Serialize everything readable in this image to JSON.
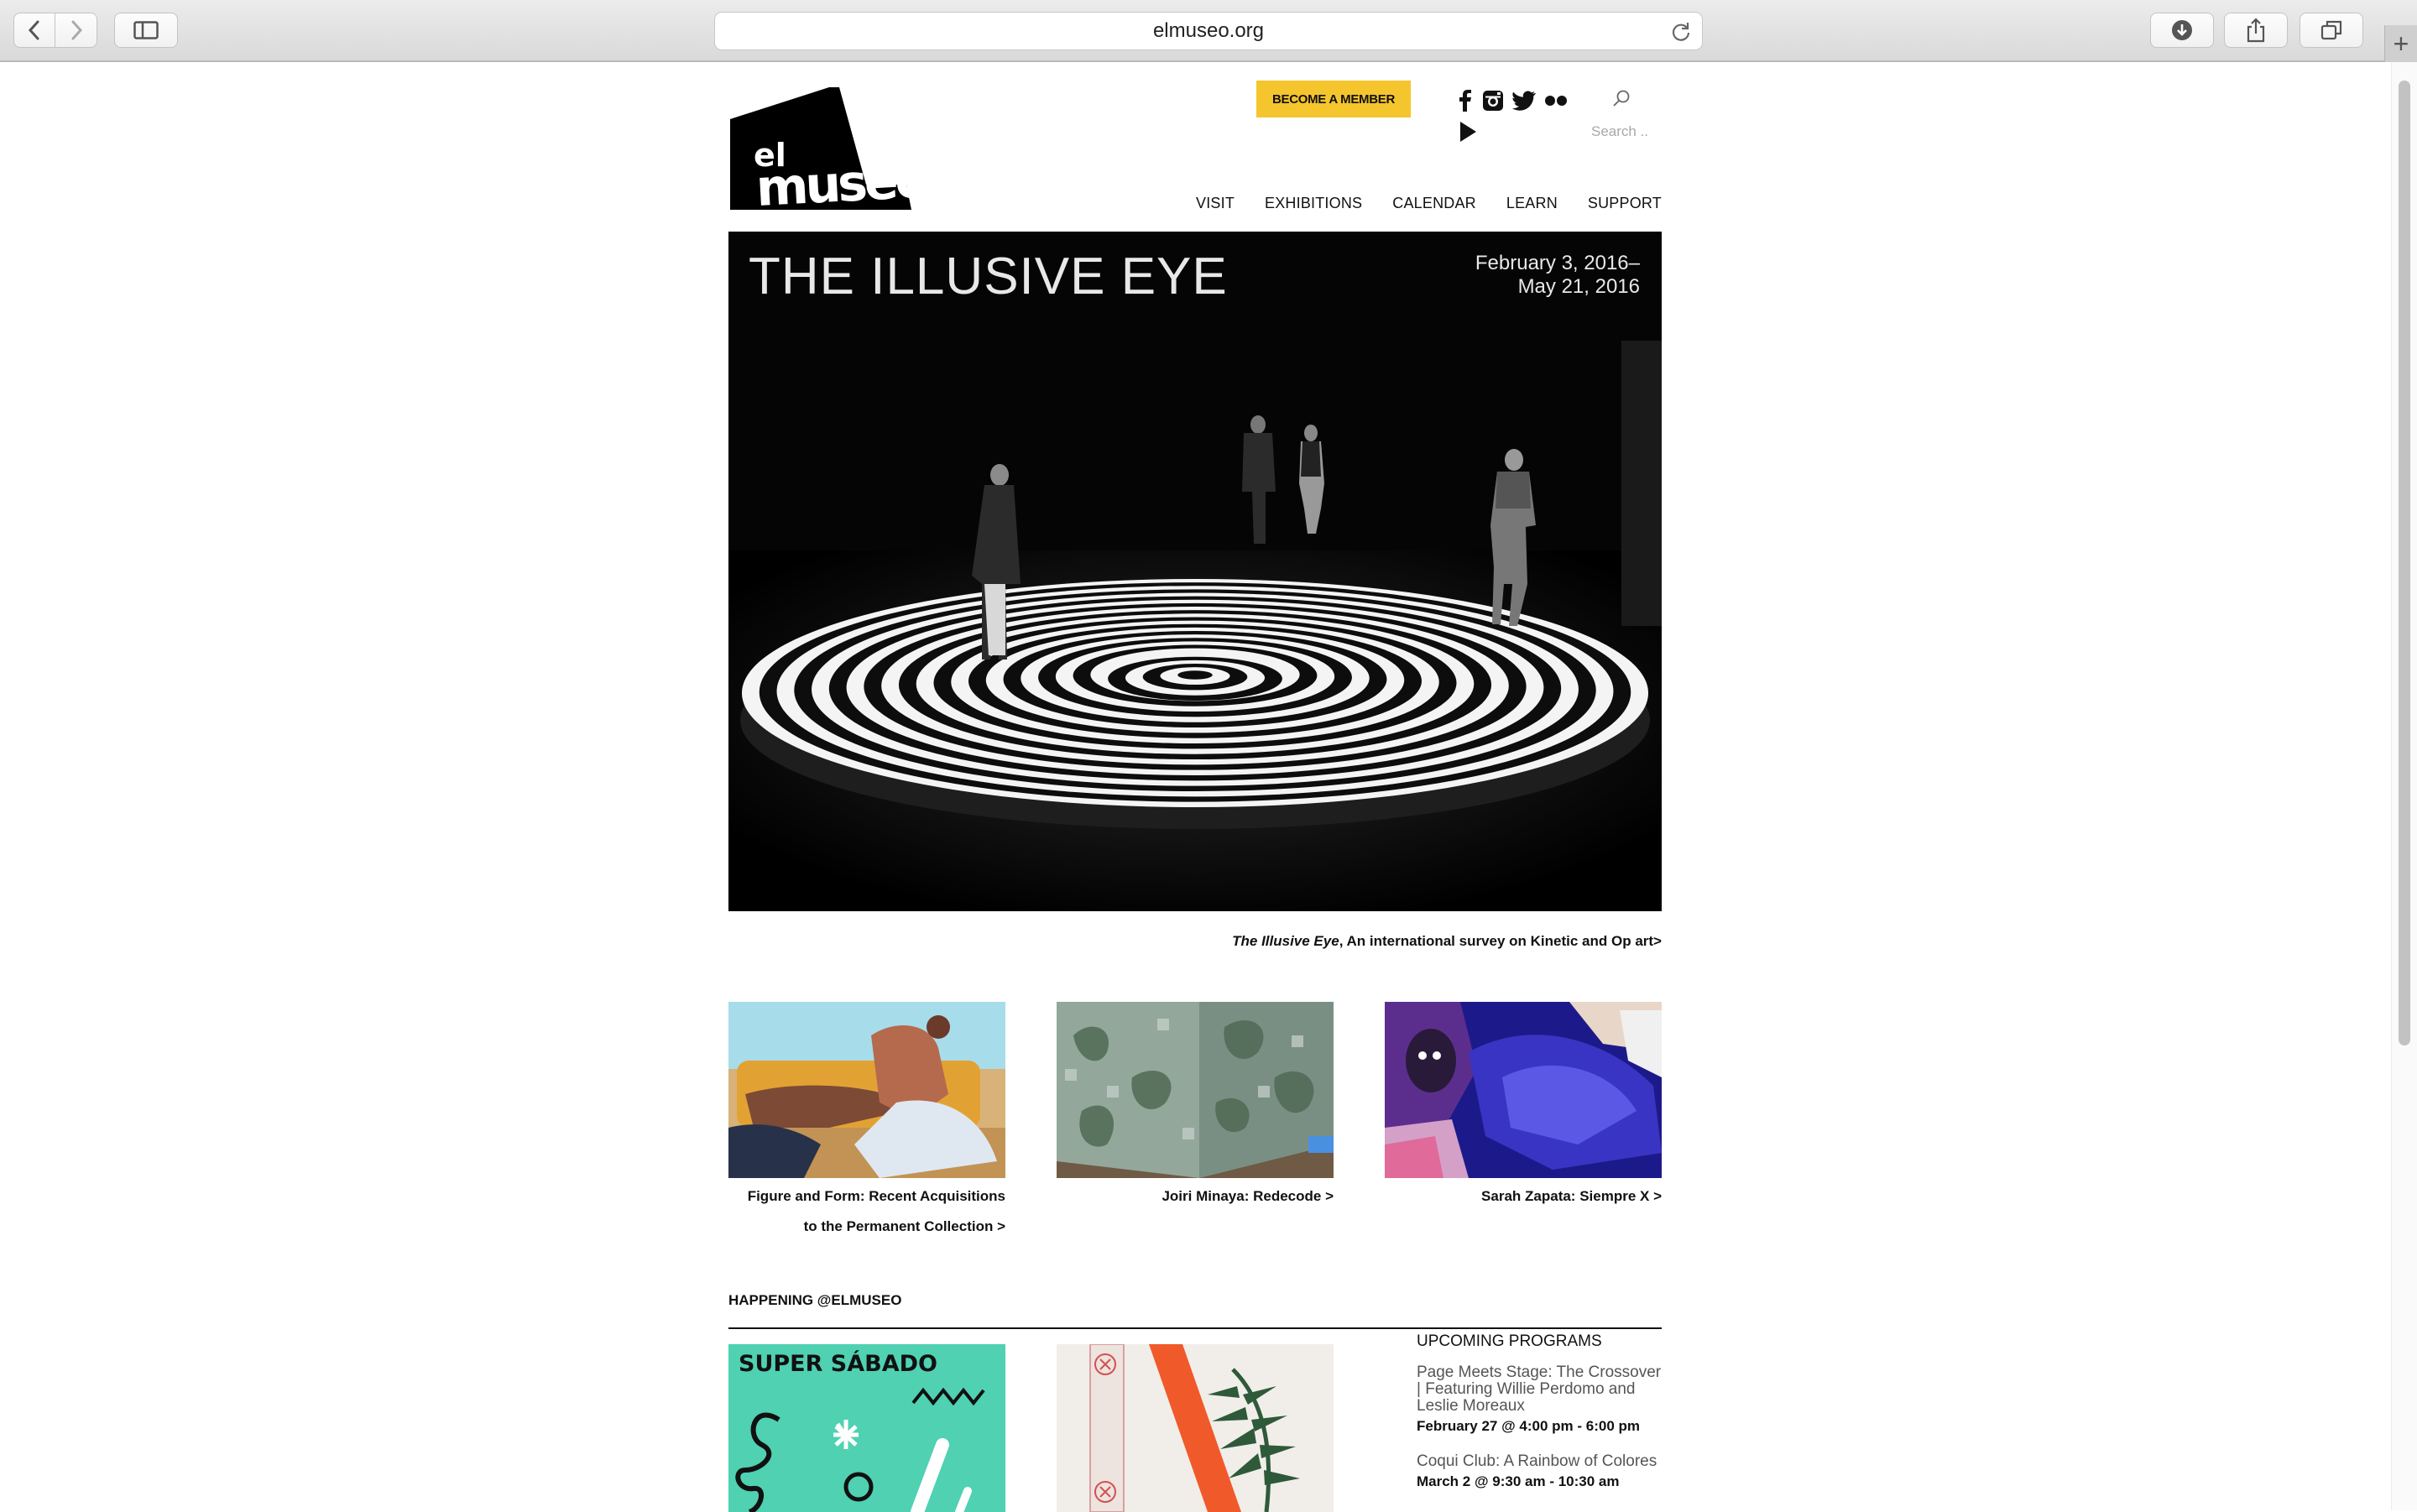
{
  "browser": {
    "url": "elmuseo.org",
    "icons": [
      "back-arrow-icon",
      "forward-arrow-icon",
      "sidebar-icon",
      "reload-icon",
      "download-icon",
      "share-icon",
      "tabs-icon",
      "plus-icon"
    ]
  },
  "header": {
    "logo_text_small": "el",
    "logo_text_large": "museo",
    "member_button": "BECOME A MEMBER",
    "social": [
      "facebook-icon",
      "instagram-icon",
      "twitter-icon",
      "flickr-icon",
      "youtube-play-icon"
    ],
    "search_placeholder": "Search ..",
    "nav": [
      "VISIT",
      "EXHIBITIONS",
      "CALENDAR",
      "LEARN",
      "SUPPORT"
    ]
  },
  "hero": {
    "title": "THE ILLUSIVE EYE",
    "date_line1": "February 3, 2016–",
    "date_line2": "May 21, 2016",
    "caption_title": "The Illusive Eye",
    "caption_rest": ", An international survey on Kinetic and Op art>"
  },
  "exhibitions": [
    {
      "caption_line1": "Figure and Form: Recent Acquisitions",
      "caption_line2": "to the Permanent Collection >"
    },
    {
      "caption_line1": "Joiri Minaya: Redecode >",
      "caption_line2": ""
    },
    {
      "caption_line1": "Sarah Zapata: Siempre X >",
      "caption_line2": ""
    }
  ],
  "happening": {
    "heading": "HAPPENING @ELMUSEO",
    "tile1_text": "SUPER SÁBADO",
    "upcoming_heading": "UPCOMING PROGRAMS",
    "events": [
      {
        "title": "Page Meets Stage: The Crossover | Featuring Willie Perdomo and Leslie Moreaux",
        "time": "February 27 @ 4:00 pm - 6:00 pm"
      },
      {
        "title": "Coqui Club: A Rainbow of Colores",
        "time": "March 2 @ 9:30 am - 10:30 am"
      }
    ]
  },
  "colors": {
    "member_button": "#f5c52d",
    "hero_bg": "#000000",
    "tile1_bg": "#4fd1b2"
  }
}
